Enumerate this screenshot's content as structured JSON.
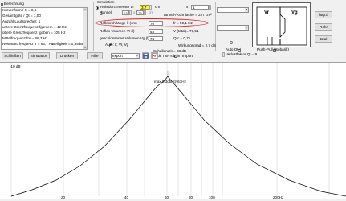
{
  "results": {
    "header": "Berechnung",
    "rows": [
      "Kurvenform / S = 0,6",
      "Gesamtgüte / Qt = 1,00",
      "Anzahl Lautsprecher: 1",
      "untere Grenzfrequenz fguntem = 42 Hz",
      "obere Grenzfrequenz fgoben = 105 Hz",
      "Mittelfrequenz fm = 66,7 Hz",
      "Resonanzfrequenz fr = 66,7 Hz"
    ],
    "ripple": "Welligkeit = 0,35dB"
  },
  "simulation": {
    "title": "Simulation",
    "pipe_label": "Rohrdurchmesser dr",
    "pipe_value": "3,7",
    "pipe_unit": "cm",
    "count_label": "x",
    "count_value": "1",
    "tunnel_label": "Tunnel",
    "tunnel_w": "15",
    "tunnel_x": "x",
    "tunnel_h": "15",
    "tunnel_unit": "cm",
    "tunnel_area": "Tunnel-/Rohrfläche = 227 cm²",
    "length_label": "Reflexrohrlänge lr (cm)",
    "length_value": "70",
    "fr_readout": "fr = 59,1 Hz",
    "vol_label": "Reflex-Volumen Vr (l)",
    "vol_value": "45",
    "vtotal": "V (total)= 76,51",
    "closed_label": "geschlossenes Volumen Vg (l)",
    "closed_value": "74",
    "qtc": "Qtc = 0,71",
    "auto_label": "Auto: lr, Vr, Vg",
    "efficiency": "Wirkungsgrad = 2,7 dB",
    "spl": "Schalldruck = 88 dB",
    "tsp_label": "Lade TSP's beim Import"
  },
  "schematic": {
    "label_vr": "Vr",
    "label_vg": "Vg"
  },
  "right_buttons": {
    "http": "http://",
    "rohr": "Rohr",
    "total": "total"
  },
  "options": {
    "autoqt": "Auto Qt",
    "pushpull": "Push-Pull (Isobarik)",
    "factor_label": "Verlustfaktor Ql = 9"
  },
  "toolbar": {
    "close": "Schließen",
    "simulation": "Simulation",
    "print": "Drucken",
    "help": "Hilfe",
    "export_value": "export"
  },
  "graph": {
    "ref_label": "-10 dB",
    "annotation": "max 9,3dB @ 61Hz",
    "x_ticks": [
      "20",
      "40",
      "60",
      "80",
      "100",
      "200Hz"
    ]
  }
}
